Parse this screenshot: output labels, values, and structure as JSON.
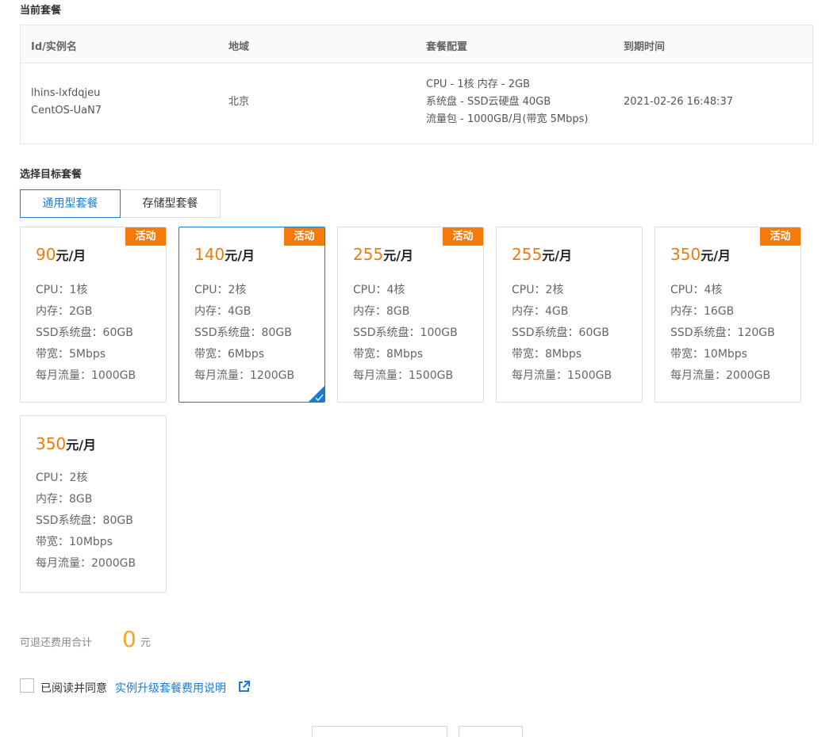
{
  "current": {
    "section_title": "当前套餐",
    "headers": [
      "Id/实例名",
      "地域",
      "套餐配置",
      "到期时间"
    ],
    "row": {
      "id": "lhins-lxfdqjeu",
      "name": "CentOS-UaN7",
      "region": "北京",
      "config": [
        "CPU - 1核 内存 - 2GB",
        "系统盘 - SSD云硬盘 40GB",
        "流量包 - 1000GB/月(带宽 5Mbps)"
      ],
      "expire": "2021-02-26 16:48:37"
    }
  },
  "target": {
    "section_title": "选择目标套餐",
    "tabs": [
      {
        "label": "通用型套餐",
        "active": true
      },
      {
        "label": "存储型套餐",
        "active": false
      }
    ],
    "cards": [
      {
        "price": "90",
        "unit": "元/月",
        "badge": "活动",
        "selected": false,
        "specs": [
          "CPU：1核",
          "内存：2GB",
          "SSD系统盘：60GB",
          "带宽：5Mbps",
          "每月流量：1000GB"
        ]
      },
      {
        "price": "140",
        "unit": "元/月",
        "badge": "活动",
        "selected": true,
        "specs": [
          "CPU：2核",
          "内存：4GB",
          "SSD系统盘：80GB",
          "带宽：6Mbps",
          "每月流量：1200GB"
        ]
      },
      {
        "price": "255",
        "unit": "元/月",
        "badge": "活动",
        "selected": false,
        "specs": [
          "CPU：4核",
          "内存：8GB",
          "SSD系统盘：100GB",
          "带宽：8Mbps",
          "每月流量：1500GB"
        ]
      },
      {
        "price": "255",
        "unit": "元/月",
        "badge": "",
        "selected": false,
        "specs": [
          "CPU：2核",
          "内存：4GB",
          "SSD系统盘：60GB",
          "带宽：8Mbps",
          "每月流量：1500GB"
        ]
      },
      {
        "price": "350",
        "unit": "元/月",
        "badge": "活动",
        "selected": false,
        "specs": [
          "CPU：4核",
          "内存：16GB",
          "SSD系统盘：120GB",
          "带宽：10Mbps",
          "每月流量：2000GB"
        ]
      },
      {
        "price": "350",
        "unit": "元/月",
        "badge": "",
        "selected": false,
        "specs": [
          "CPU：2核",
          "内存：8GB",
          "SSD系统盘：80GB",
          "带宽：10Mbps",
          "每月流量：2000GB"
        ]
      }
    ]
  },
  "refund": {
    "label": "可退还费用合计",
    "amount": "0",
    "unit": "元"
  },
  "agreement": {
    "text": "已阅读并同意",
    "link": "实例升级套餐费用说明",
    "link_icon": "external-link-icon",
    "checked": false
  },
  "colors": {
    "accent_blue": "#1a7bd5",
    "price_orange": "#f57a0c",
    "refund_orange": "#f5a623",
    "border": "#dcdcdc"
  }
}
